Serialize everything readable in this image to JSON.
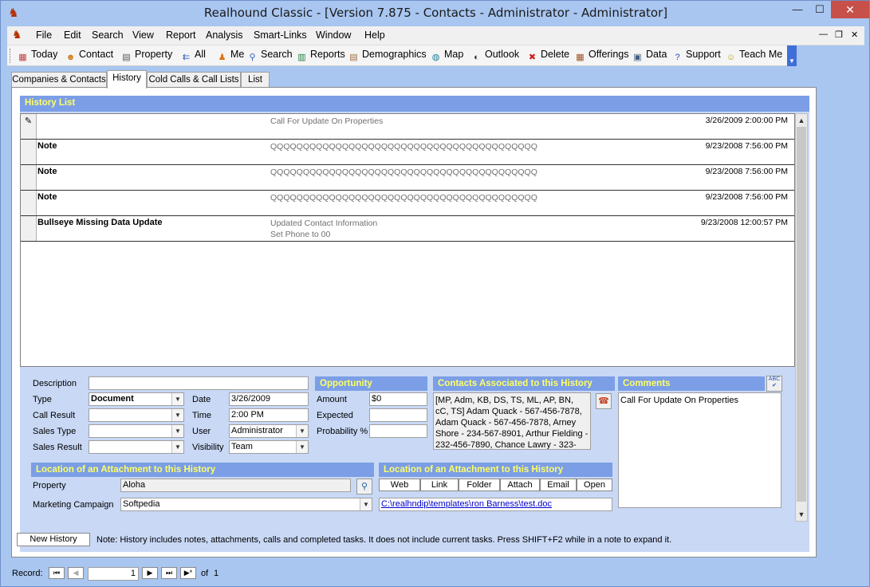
{
  "window": {
    "title": "Realhound Classic - [Version 7.875 - Contacts - Administrator - Administrator]",
    "min": "—",
    "max": "☐",
    "close": "✕"
  },
  "menu": [
    {
      "label": "File"
    },
    {
      "label": "Edit"
    },
    {
      "label": "Search"
    },
    {
      "label": "View"
    },
    {
      "label": "Report"
    },
    {
      "label": "Analysis"
    },
    {
      "label": "Smart-Links"
    },
    {
      "label": "Window"
    },
    {
      "label": "Help"
    }
  ],
  "menu_controls": {
    "min": "—",
    "restore": "❐",
    "close": "✕"
  },
  "toolbar": [
    {
      "label": "Today",
      "icon": "calendar-icon",
      "glyph": "▦",
      "color": "#c04040"
    },
    {
      "label": "Contact",
      "icon": "people-icon",
      "glyph": "☻",
      "color": "#d08020"
    },
    {
      "label": "Property",
      "icon": "building-icon",
      "glyph": "▤",
      "color": "#555555"
    },
    {
      "label": "All",
      "icon": "arrows-icon",
      "glyph": "⇇",
      "color": "#3060c0"
    },
    {
      "label": "Me",
      "icon": "person-icon",
      "glyph": "♟",
      "color": "#e07010"
    },
    {
      "label": "Search",
      "icon": "magnifier-icon",
      "glyph": "⚲",
      "color": "#3060c0"
    },
    {
      "label": "Reports",
      "icon": "bar-chart-icon",
      "glyph": "▥",
      "color": "#208040"
    },
    {
      "label": "Demographics",
      "icon": "document-icon",
      "glyph": "▤",
      "color": "#a07040"
    },
    {
      "label": "Map",
      "icon": "globe-icon",
      "glyph": "◍",
      "color": "#2080a0"
    },
    {
      "label": "Outlook",
      "icon": "outlook-icon",
      "glyph": "◐",
      "color": "#303030"
    },
    {
      "label": "Delete",
      "icon": "delete-icon",
      "glyph": "✖",
      "color": "#d02020"
    },
    {
      "label": "Offerings",
      "icon": "list-icon",
      "glyph": "▦",
      "color": "#a05020"
    },
    {
      "label": "Data",
      "icon": "network-icon",
      "glyph": "▣",
      "color": "#406080"
    },
    {
      "label": "Support",
      "icon": "help-icon",
      "glyph": "?",
      "color": "#2050c0"
    },
    {
      "label": "Teach Me",
      "icon": "smiley-icon",
      "glyph": "☺",
      "color": "#c0a000"
    }
  ],
  "tabs": [
    {
      "label": "Companies & Contacts"
    },
    {
      "label": "History"
    },
    {
      "label": "Cold Calls & Call Lists"
    },
    {
      "label": "List"
    }
  ],
  "history_list": {
    "title": "History List",
    "rows": [
      {
        "selector": "✎",
        "type": "",
        "desc1": "Call For Update On Properties",
        "desc2": "",
        "date": "3/26/2009 2:00:00 PM"
      },
      {
        "selector": "",
        "type": "Note",
        "desc1": "QQQQQQQQQQQQQQQQQQQQQQQQQQQQQQQQQQQQQQQQQ",
        "desc2": "",
        "date": "9/23/2008 7:56:00 PM"
      },
      {
        "selector": "",
        "type": "Note",
        "desc1": "QQQQQQQQQQQQQQQQQQQQQQQQQQQQQQQQQQQQQQQQQ",
        "desc2": "",
        "date": "9/23/2008 7:56:00 PM"
      },
      {
        "selector": "",
        "type": "Note",
        "desc1": "QQQQQQQQQQQQQQQQQQQQQQQQQQQQQQQQQQQQQQQQQ",
        "desc2": "",
        "date": "9/23/2008 7:56:00 PM"
      },
      {
        "selector": "",
        "type": "Bullseye Missing Data Update",
        "desc1": "Updated Contact Information",
        "desc2": "Set Phone to 00",
        "date": "9/23/2008 12:00:57 PM"
      }
    ]
  },
  "detail": {
    "description_label": "Description",
    "description_value": "",
    "type_label": "Type",
    "type_value": "Document",
    "call_result_label": "Call Result",
    "call_result_value": "",
    "sales_type_label": "Sales Type",
    "sales_type_value": "",
    "sales_result_label": "Sales Result",
    "sales_result_value": "",
    "date_label": "Date",
    "date_value": "3/26/2009",
    "time_label": "Time",
    "time_value": "2:00 PM",
    "user_label": "User",
    "user_value": "Administrator",
    "visibility_label": "Visibility",
    "visibility_value": "Team"
  },
  "opportunity": {
    "title": "Opportunity",
    "amount_label": "Amount",
    "amount_value": "$0",
    "expected_label": "Expected",
    "expected_value": "",
    "probability_label": "Probability %",
    "probability_value": ""
  },
  "contacts": {
    "title": "Contacts Associated to this History",
    "text": "[MP, Adm, KB, DS, TS, ML, AP, BN, cC, TS] Adam Quack - 567-456-7878, Adam Quack - 567-456-7878, Arney Shore - 234-567-8901, Arthur Fielding - 232-456-7890, Chance Lawry - 323-"
  },
  "comments": {
    "title": "Comments",
    "text": "Call For Update On Properties",
    "spell_icon": "ABC"
  },
  "attachment_left": {
    "title": "Location of an Attachment to this History",
    "property_label": "Property",
    "property_value": "Aloha",
    "campaign_label": "Marketing Campaign",
    "campaign_value": "Softpedia"
  },
  "attachment_right": {
    "title": "Location of an Attachment to this History",
    "buttons": [
      "Web",
      "Link",
      "Folder",
      "Attach",
      "Email",
      "Open"
    ],
    "path": "C:\\realhndip\\templates\\ron Barness\\test.doc"
  },
  "footer": {
    "new_history": "New History",
    "note": "Note:  History includes notes, attachments, calls and completed tasks.  It does not include current tasks. Press SHIFT+F2 while in a note to expand it."
  },
  "record_nav": {
    "label": "Record:",
    "current": "1",
    "of_label": "of",
    "total": "1",
    "first": "⏮",
    "prev": "◀",
    "next": "▶",
    "last": "⏭",
    "new": "▶*"
  }
}
